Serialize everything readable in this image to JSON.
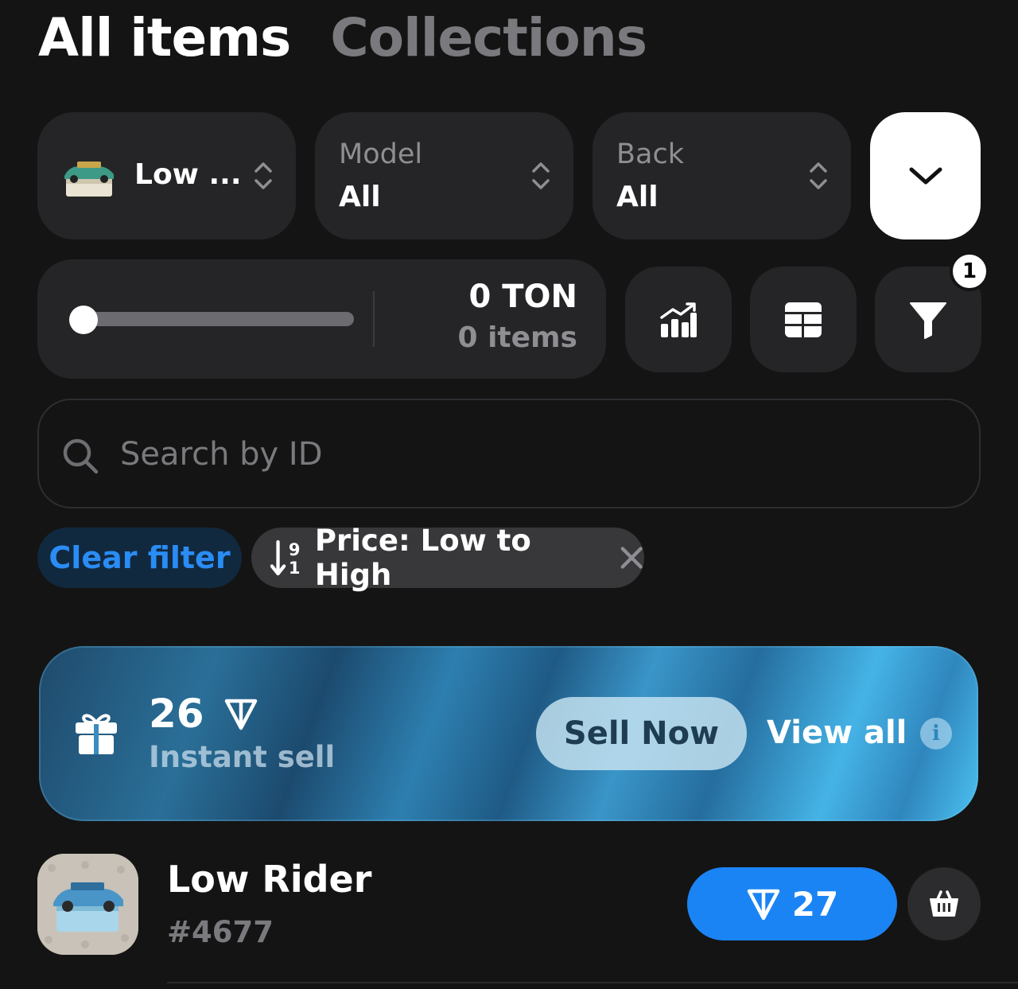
{
  "tabs": [
    {
      "label": "All items",
      "active": true
    },
    {
      "label": "Collections",
      "active": false
    }
  ],
  "filters": {
    "gift": {
      "value": "Low ..."
    },
    "model": {
      "caption": "Model",
      "value": "All"
    },
    "back": {
      "caption": "Back",
      "value": "All"
    }
  },
  "price_range": {
    "amount": "0 TON",
    "count": "0 items"
  },
  "filter_badge": "1",
  "search": {
    "placeholder": "Search by ID"
  },
  "chips": {
    "clear": "Clear filter",
    "sort": "Price: Low to High"
  },
  "banner": {
    "price": "26",
    "subtitle": "Instant sell",
    "sell_button": "Sell Now",
    "view_all": "View all",
    "info": "i"
  },
  "items": [
    {
      "name": "Low Rider",
      "number": "#4677",
      "price": "27"
    }
  ],
  "colors": {
    "accent": "#1a84f4",
    "background": "#141414",
    "surface": "#252527"
  }
}
